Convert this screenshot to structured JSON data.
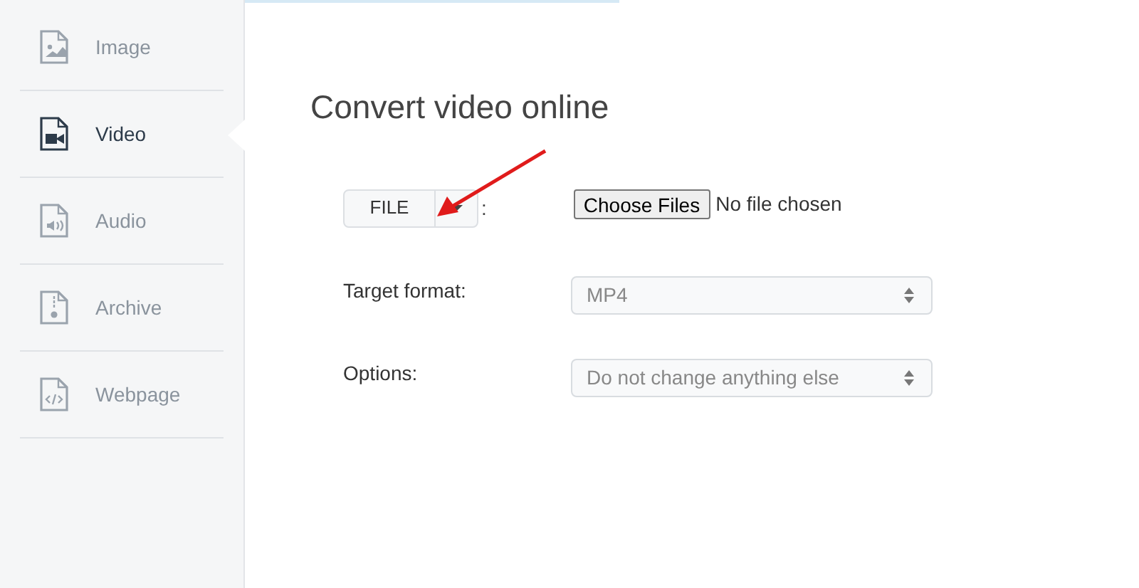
{
  "sidebar": {
    "items": [
      {
        "kind": "image",
        "label": "Image",
        "selected": false
      },
      {
        "kind": "video",
        "label": "Video",
        "selected": true
      },
      {
        "kind": "audio",
        "label": "Audio",
        "selected": false
      },
      {
        "kind": "archive",
        "label": "Archive",
        "selected": false
      },
      {
        "kind": "webpage",
        "label": "Webpage",
        "selected": false
      }
    ]
  },
  "main": {
    "title": "Convert video online",
    "source": {
      "button": "FILE",
      "separator": ":",
      "choose_button": "Choose Files",
      "file_status": "No file chosen"
    },
    "fields": [
      {
        "label": "Target format:",
        "value": "MP4"
      },
      {
        "label": "Options:",
        "value": "Do not change anything else"
      }
    ]
  }
}
